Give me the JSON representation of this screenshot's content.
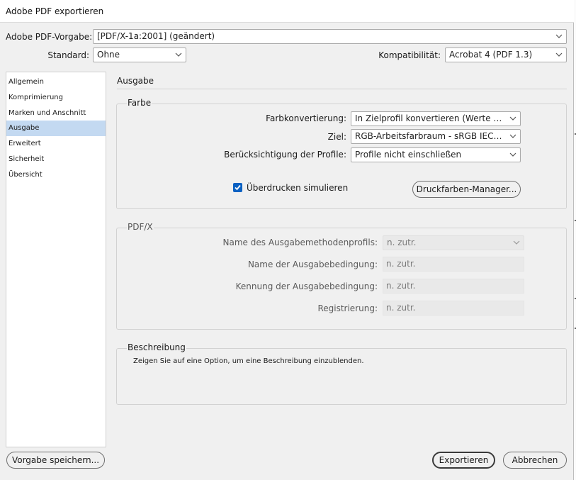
{
  "window": {
    "title": "Adobe PDF exportieren"
  },
  "header": {
    "preset_label": "Adobe PDF-Vorgabe:",
    "preset_value": "[PDF/X-1a:2001] (geändert)",
    "standard_label": "Standard:",
    "standard_value": "Ohne",
    "compat_label": "Kompatibilität:",
    "compat_value": "Acrobat 4 (PDF 1.3)"
  },
  "sidebar": {
    "selected_index": 3,
    "items": [
      {
        "label": "Allgemein"
      },
      {
        "label": "Komprimierung"
      },
      {
        "label": "Marken und Anschnitt"
      },
      {
        "label": "Ausgabe"
      },
      {
        "label": "Erweitert"
      },
      {
        "label": "Sicherheit"
      },
      {
        "label": "Übersicht"
      }
    ]
  },
  "section": {
    "title": "Ausgabe"
  },
  "farbe": {
    "title": "Farbe",
    "conversion_label": "Farbkonvertierung:",
    "conversion_value": "In Zielprofil konvertieren (Werte bei...",
    "target_label": "Ziel:",
    "target_value": "RGB-Arbeitsfarbraum - sRGB IEC619...",
    "profiles_label": "Berücksichtigung der Profile:",
    "profiles_value": "Profile nicht einschließen",
    "overprint_label": "Überdrucken simulieren",
    "overprint_checked": true,
    "ink_manager_label": "Druckfarben-Manager..."
  },
  "pdfx": {
    "title": "PDF/X",
    "profile_name_label": "Name des Ausgabemethodenprofils:",
    "profile_name_value": "n. zutr.",
    "condition_name_label": "Name der Ausgabebedingung:",
    "condition_name_value": "n. zutr.",
    "condition_id_label": "Kennung der Ausgabebedingung:",
    "condition_id_value": "n. zutr.",
    "registry_label": "Registrierung:",
    "registry_value": "n. zutr."
  },
  "description": {
    "title": "Beschreibung",
    "text": "Zeigen Sie auf eine Option, um eine Beschreibung einzublenden."
  },
  "footer": {
    "save_preset_label": "Vorgabe speichern...",
    "export_label": "Exportieren",
    "cancel_label": "Abbrechen"
  },
  "colors": {
    "selection": "#c3d9f1",
    "checkbox": "#0b61c2",
    "disabled_field": "#e9e9e9"
  },
  "icons": {
    "dropdown": "chevron-down-icon",
    "check": "checkmark-icon"
  }
}
